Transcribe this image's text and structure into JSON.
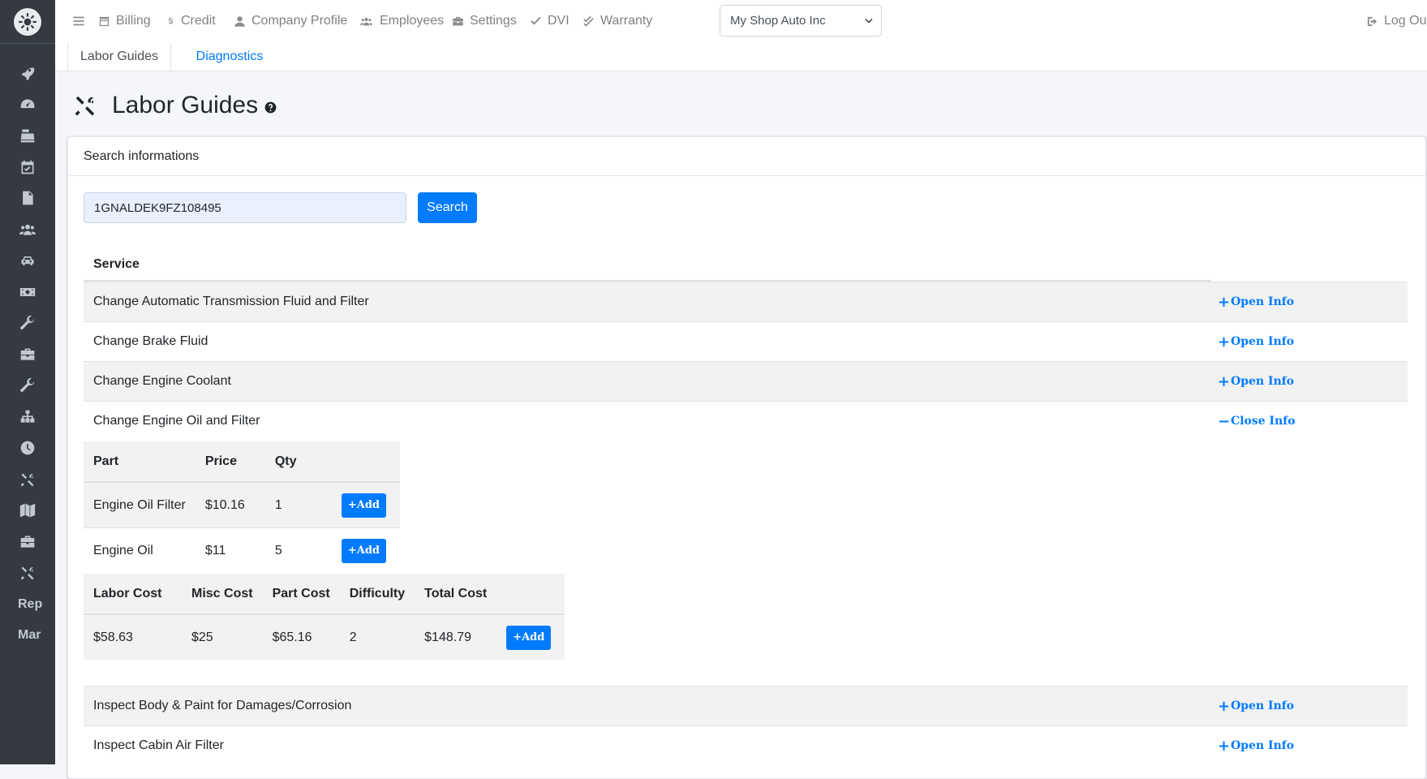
{
  "navbar": {
    "items": [
      {
        "label": "Billing",
        "icon": "billing-icon"
      },
      {
        "label": "Credit",
        "icon": "dollar-icon"
      },
      {
        "label": "Company Profile",
        "icon": "user-icon"
      },
      {
        "label": "Employees",
        "icon": "users-icon"
      },
      {
        "label": "Settings",
        "icon": "briefcase-icon"
      },
      {
        "label": "DVI",
        "icon": "check-icon"
      },
      {
        "label": "Warranty",
        "icon": "double-check-icon"
      }
    ],
    "shop_select": "My Shop Auto Inc",
    "logout": "Log Out"
  },
  "sidebar": {
    "icons": [
      "rocket-icon",
      "gauge-icon",
      "cash-register-icon",
      "calendar-check-icon",
      "invoice-icon",
      "users-icon",
      "car-icon",
      "money-bill-icon",
      "wrench-icon",
      "toolbox-icon",
      "wrench-icon",
      "sitemap-icon",
      "clock-icon",
      "tools-icon",
      "map-icon",
      "briefcase-icon",
      "tools-icon"
    ],
    "text_items": [
      "Rep",
      "Mar"
    ]
  },
  "tabs": [
    "Labor Guides",
    "Diagnostics"
  ],
  "page_title": "Labor Guides",
  "card": {
    "header": "Search informations",
    "vin": "1GNALDEK9FZ108495",
    "search_button": "Search"
  },
  "services": {
    "header": "Service",
    "open_label": "Open Info",
    "close_label": "Close Info",
    "rows": [
      {
        "name": "Change Automatic Transmission Fluid and Filter",
        "action": "Open Info"
      },
      {
        "name": "Change Brake Fluid",
        "action": "Open Info"
      },
      {
        "name": "Change Engine Coolant",
        "action": "Open Info"
      },
      {
        "name": "Change Engine Oil and Filter",
        "action": "Close Info"
      },
      {
        "name": "Inspect Body & Paint for Damages/Corrosion",
        "action": "Open Info"
      },
      {
        "name": "Inspect Cabin Air Filter",
        "action": "Open Info"
      }
    ]
  },
  "parts": {
    "headers": [
      "Part",
      "Price",
      "Qty"
    ],
    "rows": [
      {
        "part": "Engine Oil Filter",
        "price": "$10.16",
        "qty": "1"
      },
      {
        "part": "Engine Oil",
        "price": "$11",
        "qty": "5"
      }
    ],
    "add_label": "Add"
  },
  "costs": {
    "headers": [
      "Labor Cost",
      "Misc Cost",
      "Part Cost",
      "Difficulty",
      "Total Cost"
    ],
    "row": {
      "labor": "$58.63",
      "misc": "$25",
      "part": "$65.16",
      "difficulty": "2",
      "total": "$148.79"
    },
    "add_label": "Add"
  },
  "colors": {
    "primary": "#007bff",
    "sidebar": "#343a40"
  }
}
